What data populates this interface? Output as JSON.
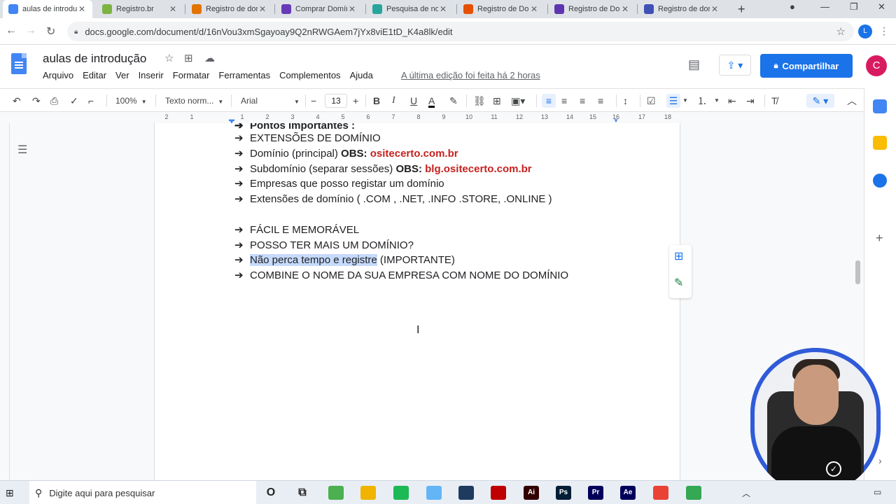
{
  "browser": {
    "tabs": [
      {
        "title": "aulas de introdução",
        "color": "#4285f4",
        "active": true
      },
      {
        "title": "Registro.br",
        "color": "#7cb342"
      },
      {
        "title": "Registro de domínio",
        "color": "#e37400"
      },
      {
        "title": "Comprar Domínio",
        "color": "#673ab7"
      },
      {
        "title": "Pesquisa de nomes",
        "color": "#26a69a"
      },
      {
        "title": "Registro de Domínio",
        "color": "#e65100"
      },
      {
        "title": "Registro de Domínio",
        "color": "#5e35b1"
      },
      {
        "title": "Registro de domínio",
        "color": "#3f51b5"
      }
    ],
    "tab_close": "✕",
    "new_tab": "+",
    "url": "docs.google.com/document/d/16nVou3xmSgayoay9Q2nRWGAem7jYx8viE1tD_K4a8lk/edit",
    "profile_initial": "L"
  },
  "doc": {
    "title": "aulas de introdução",
    "menu": [
      "Arquivo",
      "Editar",
      "Ver",
      "Inserir",
      "Formatar",
      "Ferramentas",
      "Complementos",
      "Ajuda"
    ],
    "last_edit": "A última edição foi feita há 2 horas",
    "share_label": "Compartilhar",
    "user_initial": "C"
  },
  "toolbar": {
    "zoom": "100%",
    "style": "Texto norm...",
    "font": "Arial",
    "font_size": "13"
  },
  "ruler": {
    "numbers": [
      "2",
      "1",
      "1",
      "2",
      "3",
      "4",
      "5",
      "6",
      "7",
      "8",
      "9",
      "10",
      "11",
      "12",
      "13",
      "14",
      "15",
      "16",
      "17",
      "18"
    ]
  },
  "content": {
    "cut_line": "Pontos importantes :",
    "arrow": "➔",
    "lines": [
      {
        "text": "EXTENSÕES DE DOMÍNIO"
      },
      {
        "text": "Domínio (principal) ",
        "bold": "OBS: ",
        "red": "ositecerto.com.br"
      },
      {
        "text": "Subdomínio (separar sessões) ",
        "bold": "OBS: ",
        "red": "blg.ositecerto.com.br"
      },
      {
        "text": "Empresas que posso registar um domínio"
      },
      {
        "text": "Extensões de domínio ( .COM , .NET, .INFO .STORE, .ONLINE )"
      },
      {
        "text": ""
      },
      {
        "text": "FÁCIL E MEMORÁVEL"
      },
      {
        "text": "POSSO TER MAIS UM DOMÍNIO?"
      },
      {
        "highlight": "Não perca tempo e registre",
        "text": " (IMPORTANTE)"
      },
      {
        "text": "COMBINE O NOME DA SUA EMPRESA COM NOME DO DOMÍNIO"
      }
    ]
  },
  "taskbar": {
    "search_placeholder": "Digite aqui para pesquisar",
    "apps": [
      {
        "name": "cortana",
        "label": "O",
        "color": "#e9eef5"
      },
      {
        "name": "task-view",
        "label": "⧉",
        "color": "#e9eef5"
      },
      {
        "name": "app-1",
        "label": "",
        "color": "#4caf50"
      },
      {
        "name": "file-explorer",
        "label": "",
        "color": "#f0b400"
      },
      {
        "name": "spotify",
        "label": "",
        "color": "#1db954"
      },
      {
        "name": "app-2",
        "label": "",
        "color": "#64b5f6"
      },
      {
        "name": "app-3",
        "label": "",
        "color": "#1e3a5f"
      },
      {
        "name": "filezilla",
        "label": "",
        "color": "#bf0000"
      },
      {
        "name": "illustrator",
        "label": "Ai",
        "color": "#330000"
      },
      {
        "name": "photoshop",
        "label": "Ps",
        "color": "#001e36"
      },
      {
        "name": "premiere",
        "label": "Pr",
        "color": "#00005b"
      },
      {
        "name": "after-effects",
        "label": "Ae",
        "color": "#00005b"
      },
      {
        "name": "chrome",
        "label": "",
        "color": "#ea4335"
      },
      {
        "name": "chrome-profile",
        "label": "",
        "color": "#34a853"
      }
    ]
  },
  "colors": {
    "accent": "#1a73e8",
    "link_red": "#c5221f",
    "selection": "#c6dafc"
  }
}
